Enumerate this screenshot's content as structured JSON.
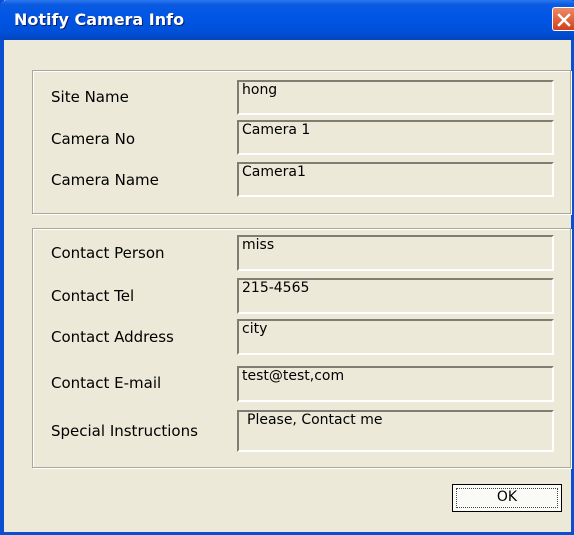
{
  "window": {
    "title": "Notify Camera Info"
  },
  "camera": {
    "site_name_label": "Site Name",
    "site_name_value": "hong",
    "camera_no_label": "Camera No",
    "camera_no_value": "Camera 1",
    "camera_name_label": "Camera Name",
    "camera_name_value": "Camera1"
  },
  "contact": {
    "person_label": "Contact Person",
    "person_value": "miss",
    "tel_label": "Contact Tel",
    "tel_value": "215-4565",
    "address_label": "Contact Address",
    "address_value": "city",
    "email_label": "Contact E-mail",
    "email_value": "test@test,com",
    "instructions_label": "Special Instructions",
    "instructions_value": "Please, Contact me"
  },
  "buttons": {
    "ok_label": "OK"
  },
  "icons": {
    "close": "close-icon"
  },
  "colors": {
    "titlebar": "#0055e5",
    "dialog_bg": "#ece9d8",
    "close_button": "#d3401b"
  }
}
